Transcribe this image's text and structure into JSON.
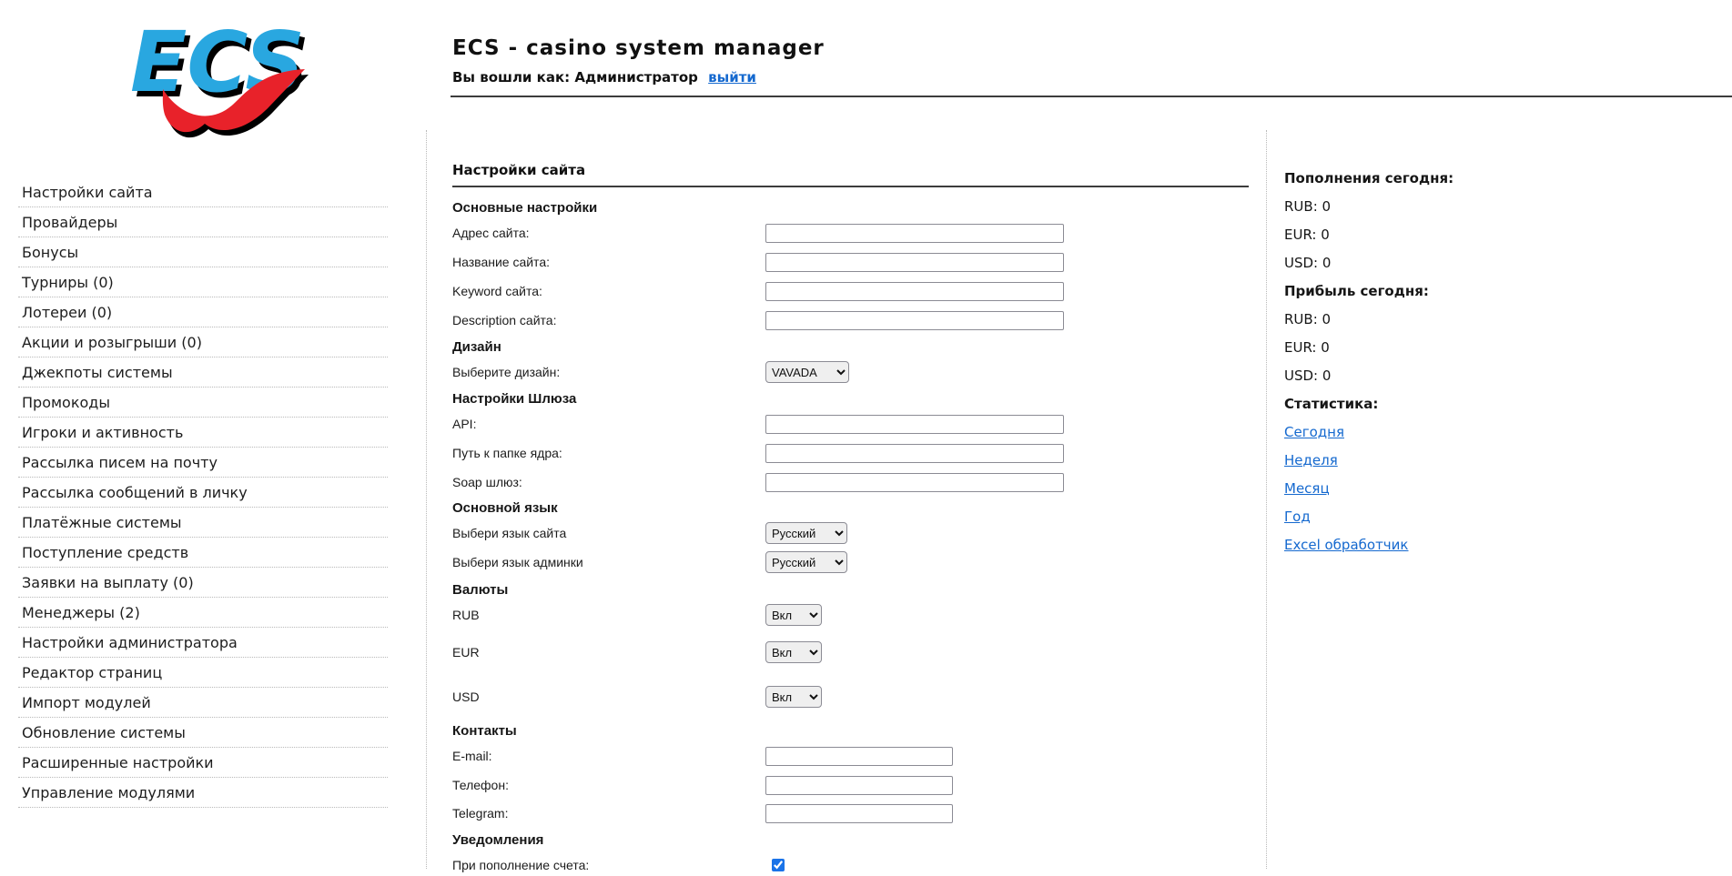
{
  "header": {
    "logo_text": "ECS",
    "title": "ECS - casino system manager",
    "login_prefix": "Вы вошли как: Администратор",
    "logout_label": "выйти"
  },
  "sidebar": {
    "items": [
      "Настройки сайта",
      "Провайдеры",
      "Бонусы",
      "Турниры (0)",
      "Лотереи (0)",
      "Акции и розыгрыши (0)",
      "Джекпоты системы",
      "Промокоды",
      "Игроки и активность",
      "Рассылка писем на почту",
      "Рассылка сообщений в личку",
      "Платёжные системы",
      "Поступление средств",
      "Заявки на выплату (0)",
      "Менеджеры (2)",
      "Настройки администратора",
      "Редактор страниц",
      "Импорт модулей",
      "Обновление системы",
      "Расширенные настройки",
      "Управление модулями"
    ]
  },
  "main": {
    "title": "Настройки сайта",
    "rows": [
      {
        "type": "section",
        "label": "Основные настройки"
      },
      {
        "type": "text",
        "label": "Адрес сайта:",
        "value": ""
      },
      {
        "type": "text",
        "label": "Название сайта:",
        "value": ""
      },
      {
        "type": "text",
        "label": "Keyword сайта:",
        "value": ""
      },
      {
        "type": "text",
        "label": "Description сайта:",
        "value": ""
      },
      {
        "type": "section",
        "label": "Дизайн"
      },
      {
        "type": "select",
        "label": "Выберите дизайн:",
        "value": "VAVADA"
      },
      {
        "type": "section",
        "label": "Настройки Шлюза"
      },
      {
        "type": "text",
        "label": "API:",
        "value": ""
      },
      {
        "type": "text",
        "label": "Путь к папке ядра:",
        "value": ""
      },
      {
        "type": "text",
        "label": "Soap шлюз:",
        "value": ""
      },
      {
        "type": "section",
        "label": "Основной язык"
      },
      {
        "type": "select",
        "label": "Выбери язык сайта",
        "value": "Русский"
      },
      {
        "type": "select",
        "label": "Выбери язык админки",
        "value": "Русский"
      },
      {
        "type": "section",
        "label": "Валюты"
      },
      {
        "type": "select",
        "label": "RUB",
        "value": "Вкл"
      },
      {
        "type": "select",
        "label": "EUR",
        "value": "Вкл"
      },
      {
        "type": "select",
        "label": "USD",
        "value": "Вкл"
      },
      {
        "type": "section",
        "label": "Контакты"
      },
      {
        "type": "text",
        "label": "E-mail:",
        "value": ""
      },
      {
        "type": "text",
        "label": "Телефон:",
        "value": ""
      },
      {
        "type": "text",
        "label": "Telegram:",
        "value": ""
      },
      {
        "type": "section",
        "label": "Уведомления"
      },
      {
        "type": "checkbox",
        "label": "При пополнение счета:",
        "checked": true
      }
    ]
  },
  "stats": {
    "deposits_title": "Пополнения сегодня:",
    "deposit_values": [
      "RUB: 0",
      "EUR: 0",
      "USD: 0"
    ],
    "profit_title": "Прибыль сегодня:",
    "profit_values": [
      "RUB: 0",
      "EUR: 0",
      "USD: 0"
    ],
    "section_title": "Статистика:",
    "links": [
      "Сегодня",
      "Неделя",
      "Месяц",
      "Год",
      "Excel обработчик"
    ]
  },
  "colors": {
    "link_blue": "#1569cf",
    "checkbox_blue": "#1a73e8",
    "logo_blue": "#29a7e0",
    "logo_red": "#e8222a"
  }
}
